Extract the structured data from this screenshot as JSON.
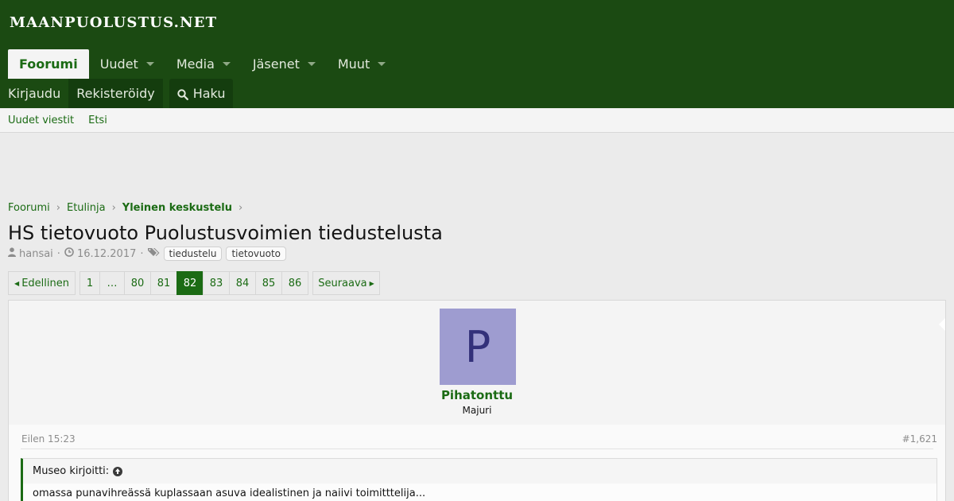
{
  "site": {
    "logo": "MAANPUOLUSTUS.NET"
  },
  "nav": {
    "tabs": [
      {
        "label": "Foorumi",
        "active": true,
        "dropdown": false
      },
      {
        "label": "Uudet",
        "active": false,
        "dropdown": true
      },
      {
        "label": "Media",
        "active": false,
        "dropdown": true
      },
      {
        "label": "Jäsenet",
        "active": false,
        "dropdown": true
      },
      {
        "label": "Muut",
        "active": false,
        "dropdown": true
      }
    ]
  },
  "userbar": {
    "login": "Kirjaudu",
    "register": "Rekisteröidy",
    "search": "Haku"
  },
  "subnav": {
    "items": [
      "Uudet viestit",
      "Etsi"
    ]
  },
  "breadcrumb": {
    "items": [
      "Foorumi",
      "Etulinja",
      "Yleinen keskustelu"
    ]
  },
  "thread": {
    "title": "HS tietovuoto Puolustusvoimien tiedustelusta",
    "author": "hansai",
    "date": "16.12.2017",
    "tags": [
      "tiedustelu",
      "tietovuoto"
    ]
  },
  "pagination": {
    "prev_label": "Edellinen",
    "next_label": "Seuraava",
    "pages": [
      "1",
      "…",
      "80",
      "81",
      "82",
      "83",
      "84",
      "85",
      "86"
    ],
    "current": "82"
  },
  "post": {
    "avatar_letter": "P",
    "username": "Pihatonttu",
    "user_title": "Majuri",
    "date": "Eilen 15:23",
    "number": "#1,621",
    "quote_author": "Museo kirjoitti:",
    "quote_text": "omassa punavihreässä kuplassaan asuva idealistinen ja naiivi toimitttelija..."
  },
  "colors": {
    "header_bg": "#1b4a12",
    "accent": "#1b6b14",
    "avatar_bg": "#9e9cd0"
  }
}
